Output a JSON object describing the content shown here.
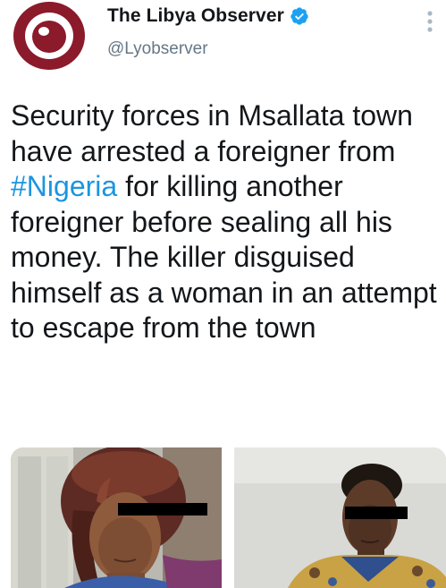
{
  "tweet": {
    "author": {
      "display_name": "The Libya Observer",
      "handle": "@Lyobserver",
      "verified": true,
      "avatar_icon": "libya-observer-logo",
      "brand_color": "#8b1a2b"
    },
    "text": {
      "part1": "Security forces in Msallata town have arrested a foreigner from ",
      "hashtag": "#Nigeria",
      "part2": " for killing another foreigner before sealing all his money. The killer disguised himself as a woman in an attempt to escape from the town"
    },
    "media": [
      {
        "kind": "photo",
        "subject": "suspect-in-womens-clothing"
      },
      {
        "kind": "photo",
        "subject": "suspect-without-disguise"
      }
    ],
    "colors": {
      "text": "#14171a",
      "secondary": "#657786",
      "link": "#1b95e0",
      "verified": "#1da1f2"
    }
  }
}
